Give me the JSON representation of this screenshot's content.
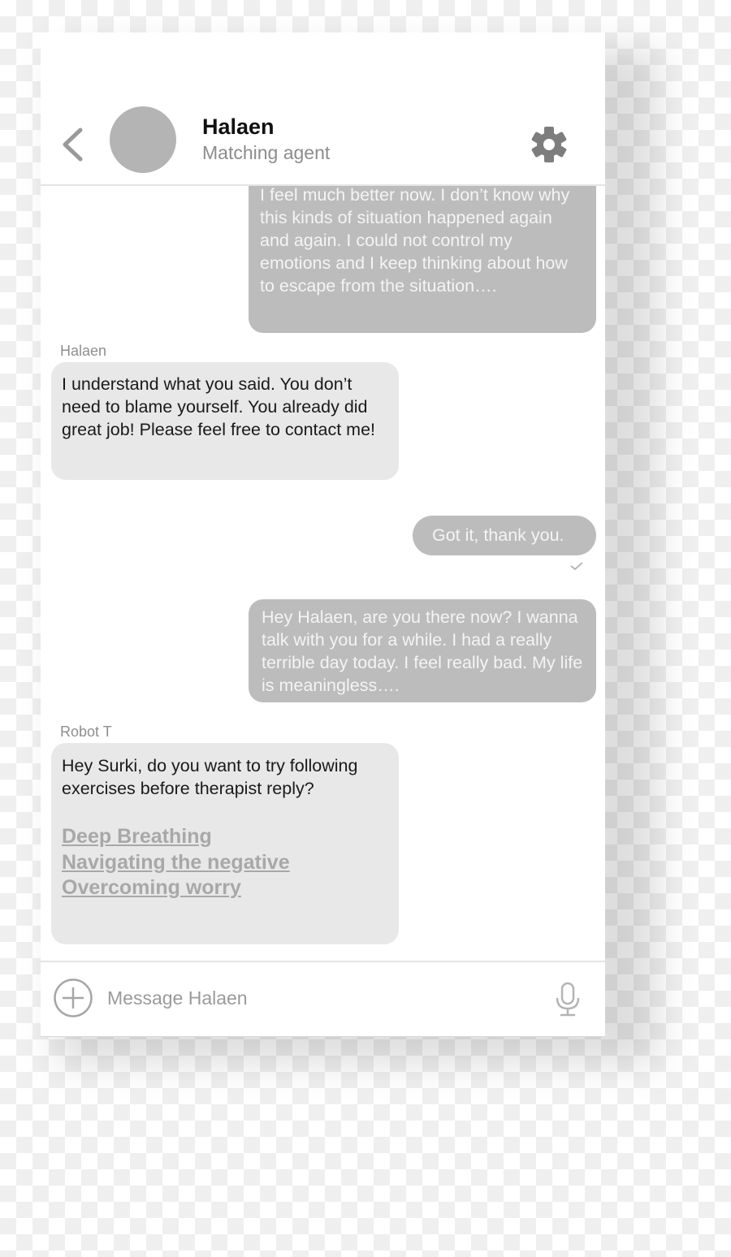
{
  "header": {
    "contact_name": "Halaen",
    "contact_role": "Matching agent",
    "back_icon": "chevron-left-icon",
    "settings_icon": "gear-icon"
  },
  "messages": [
    {
      "direction": "outgoing",
      "text": "I feel much better now. I don’t know why this kinds of situation happened again and again. I could not control my emotions and I keep thinking about how to escape from the situation…."
    },
    {
      "direction": "incoming",
      "sender": "Halaen",
      "text": "I understand what you said. You don’t need to blame yourself. You already did great job! Please feel free to contact me!"
    },
    {
      "direction": "outgoing",
      "text": "Got it, thank you.",
      "status": "delivered"
    },
    {
      "direction": "outgoing",
      "text": "Hey Halaen, are you there now? I wanna talk with you for a while. I had a really terrible day today. I feel really bad. My life is meaningless…."
    },
    {
      "direction": "incoming",
      "sender": "Robot T",
      "text": "Hey Surki, do you want to try following exercises before therapist reply?",
      "links": [
        "Deep Breathing",
        "Navigating the negative",
        "Overcoming worry"
      ]
    }
  ],
  "composer": {
    "placeholder": "Message Halaen",
    "value": "",
    "add_icon": "plus-circle-icon",
    "mic_icon": "microphone-icon"
  },
  "colors": {
    "outgoing_bubble": "#bcbcbc",
    "incoming_bubble": "#e8e8e8",
    "avatar": "#b4b4b4",
    "link": "#a8a8a8"
  }
}
